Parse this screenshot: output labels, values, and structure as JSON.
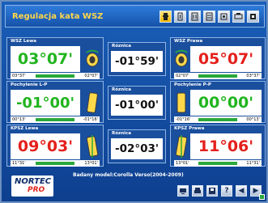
{
  "header": {
    "title": "Regulacja kata WSZ",
    "toolbar_icons": [
      "wheel-tool-icon",
      "page-1-icon",
      "page-2-icon",
      "page-3-icon",
      "page-4-icon",
      "page-5-icon",
      "page-6-icon"
    ]
  },
  "colors": {
    "background": "#0e3f8f",
    "header_bg": "#1552a8",
    "title_text": "#ffd84a",
    "in_tolerance": "#21b41e",
    "out_of_tolerance": "#e4201b",
    "tolerance_bar": "#2aa83a"
  },
  "rows": [
    {
      "left": {
        "label": "WSZ Lewa",
        "value": "03°07'",
        "status": "green",
        "tol_min": "03°37'",
        "tol_max": "02°07'"
      },
      "middle": {
        "label": "Róznica",
        "value": "-01°59'"
      },
      "right": {
        "label": "WSZ Prawa",
        "value": "05°07'",
        "status": "red",
        "tol_min": "02°07'",
        "tol_max": "03°37'"
      }
    },
    {
      "left": {
        "label": "Pochylenie L-P",
        "value": "-01°00'",
        "status": "green",
        "tol_min": "00°13'",
        "tol_max": "-01°16'"
      },
      "middle": {
        "label": "Róznica",
        "value": "-01°00'"
      },
      "right": {
        "label": "Pochylenie P-P",
        "value": "00°00'",
        "status": "green",
        "tol_min": "-01°16'",
        "tol_max": "00°13'"
      }
    },
    {
      "left": {
        "label": "KPSZ Lewa",
        "value": "09°03'",
        "status": "red",
        "tol_min": "11°31'",
        "tol_max": "13°01'"
      },
      "middle": {
        "label": "Róznica",
        "value": "-02°03'"
      },
      "right": {
        "label": "KPSZ Prawa",
        "value": "11°06'",
        "status": "red",
        "tol_min": "13°01'",
        "tol_max": "11°31'"
      }
    }
  ],
  "footer": {
    "logo_line1": "NORTEC",
    "logo_line2": "PRO",
    "model_text": "Badany model:Corolla Verso(2004-2009)",
    "buttons": [
      "screen-icon",
      "print-icon",
      "save-icon",
      "?",
      "◀",
      "▶"
    ]
  }
}
